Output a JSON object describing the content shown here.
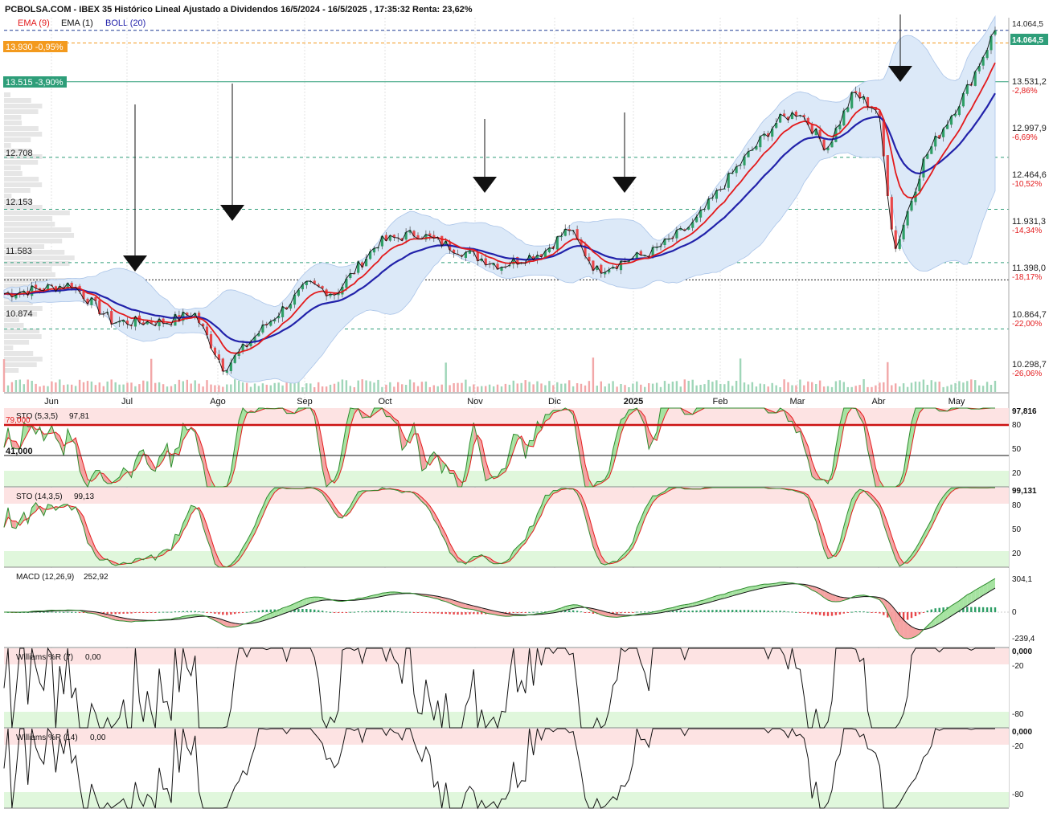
{
  "header": {
    "title": "PCBOLSA.COM - IBEX 35 Histórico Lineal Ajustado a Dividendos 16/5/2024 - 16/5/2025 , 17:35:32 Renta: 23,62%",
    "legend": [
      {
        "label": "EMA (9)",
        "color": "#e31a1c"
      },
      {
        "label": "EMA (1)",
        "color": "#111111"
      },
      {
        "label": "BOLL (20)",
        "color": "#2222aa"
      }
    ]
  },
  "colors": {
    "up": "#2e9e66",
    "down": "#e8474a",
    "ema9": "#e31a1c",
    "ema_slow": "#2222aa",
    "boll_fill": "#dce9f8",
    "overbought": "#fde3e3",
    "oversold": "#e0f7dc",
    "orange": "#f39a1e",
    "teal": "#2e9e79"
  },
  "price_tags": [
    {
      "label": "13.930 -0,95%",
      "value": 13930,
      "color": "#f39a1e"
    },
    {
      "label": "13.515 -3,90%",
      "value": 13515,
      "color": "#2e9e79"
    },
    {
      "label": "14.064,5",
      "value": 14064.5,
      "color": "#2e9e79"
    }
  ],
  "support_labels": [
    {
      "label": "12.708",
      "value": 12708
    },
    {
      "label": "12.153",
      "value": 12153
    },
    {
      "label": "11.583",
      "value": 11583
    },
    {
      "label": "10.874",
      "value": 10874
    }
  ],
  "right_axis": [
    {
      "price": "14.064,5",
      "pct": "",
      "value": 14064.5
    },
    {
      "price": "13.531,2",
      "pct": "-2,86%",
      "value": 13531.2
    },
    {
      "price": "12.997,9",
      "pct": "-6,69%",
      "value": 12997.9
    },
    {
      "price": "12.464,6",
      "pct": "-10,52%",
      "value": 12464.6
    },
    {
      "price": "11.931,3",
      "pct": "-14,34%",
      "value": 11931.3
    },
    {
      "price": "11.398,0",
      "pct": "-18,17%",
      "value": 11398.0
    },
    {
      "price": "10.864,7",
      "pct": "-22,00%",
      "value": 10864.7
    },
    {
      "price": "10.298,7",
      "pct": "-26,06%",
      "value": 10298.7
    }
  ],
  "months": [
    "Jun",
    "Jul",
    "Ago",
    "Sep",
    "Oct",
    "Nov",
    "Dic",
    "2025",
    "Feb",
    "Mar",
    "Abr",
    "May"
  ],
  "sto1": {
    "label": "STO (5,3,5)",
    "value": "97,81",
    "axis_top": "97,816",
    "axis": [
      "80",
      "50",
      "20"
    ],
    "level_top": "79,000",
    "level_bottom": "41,000"
  },
  "sto2": {
    "label": "STO (14,3,5)",
    "value": "99,13",
    "axis_top": "99,131",
    "axis": [
      "80",
      "50",
      "20"
    ]
  },
  "macd": {
    "label": "MACD (12,26,9)",
    "value": "252,92",
    "axis": [
      "304,1",
      "0",
      "-239,4"
    ]
  },
  "will7": {
    "label": "Williams %R (7)",
    "value": "0,00",
    "axis_top": "0,000",
    "axis": [
      "-20",
      "-80"
    ]
  },
  "will14": {
    "label": "Williams %R (14)",
    "value": "0,00",
    "axis_top": "0,000",
    "axis": [
      "-20",
      "-80"
    ]
  },
  "chart_data": {
    "type": "line",
    "title": "PCBOLSA.COM - IBEX 35 Histórico Lineal Ajustado a Dividendos 16/5/2024 - 16/5/2025 , 17:35:32 Renta: 23,62%",
    "x_range": [
      "2024-05-16",
      "2025-05-16"
    ],
    "ylim": [
      10200,
      14200
    ],
    "key_points": [
      {
        "x": "2024-05-16",
        "y": 11250
      },
      {
        "x": "2024-06-10",
        "y": 11350
      },
      {
        "x": "2024-06-25",
        "y": 10950
      },
      {
        "x": "2024-07-15",
        "y": 10950
      },
      {
        "x": "2024-07-25",
        "y": 11050
      },
      {
        "x": "2024-08-05",
        "y": 10450
      },
      {
        "x": "2024-08-20",
        "y": 10900
      },
      {
        "x": "2024-09-05",
        "y": 11350
      },
      {
        "x": "2024-09-15",
        "y": 11250
      },
      {
        "x": "2024-10-01",
        "y": 11800
      },
      {
        "x": "2024-10-15",
        "y": 11900
      },
      {
        "x": "2024-11-01",
        "y": 11700
      },
      {
        "x": "2024-11-15",
        "y": 11550
      },
      {
        "x": "2024-12-01",
        "y": 11700
      },
      {
        "x": "2024-12-10",
        "y": 11950
      },
      {
        "x": "2024-12-20",
        "y": 11500
      },
      {
        "x": "2025-01-10",
        "y": 11700
      },
      {
        "x": "2025-01-25",
        "y": 12000
      },
      {
        "x": "2025-02-10",
        "y": 12600
      },
      {
        "x": "2025-02-25",
        "y": 13100
      },
      {
        "x": "2025-03-05",
        "y": 13200
      },
      {
        "x": "2025-03-15",
        "y": 12800
      },
      {
        "x": "2025-03-25",
        "y": 13400
      },
      {
        "x": "2025-04-03",
        "y": 13200
      },
      {
        "x": "2025-04-09",
        "y": 11700
      },
      {
        "x": "2025-04-20",
        "y": 12700
      },
      {
        "x": "2025-05-05",
        "y": 13400
      },
      {
        "x": "2025-05-16",
        "y": 14064.5
      }
    ],
    "series": [
      {
        "name": "EMA (9)"
      },
      {
        "name": "EMA (1)"
      },
      {
        "name": "BOLL (20)"
      }
    ],
    "grid": true
  }
}
